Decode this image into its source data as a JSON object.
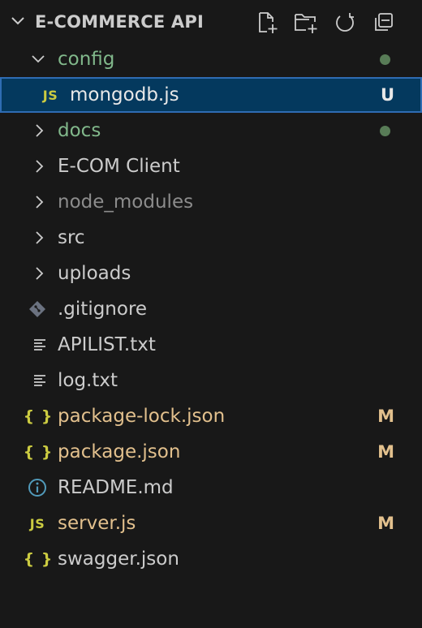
{
  "explorer": {
    "title": "E-COMMERCE API",
    "actions": [
      "new-file",
      "new-folder",
      "refresh",
      "collapse-all"
    ]
  },
  "colors": {
    "folder_modified": "#81b88b",
    "modified_file": "#e2c08d",
    "default_text": "#cccccc",
    "ignored_text": "#8c8c8c",
    "untracked_text": "#e8e8e8",
    "selection_bg": "#04395e",
    "selection_border": "#2f6cb3",
    "js_icon": "#cbcb41",
    "json_icon": "#cbcb41",
    "info_icon": "#519aba",
    "git_icon": "#6b7280"
  },
  "items": [
    {
      "label": "config",
      "kind": "folder",
      "expanded": true,
      "badge": "",
      "dot": true
    },
    {
      "label": "mongodb.js",
      "kind": "js",
      "badge": "U",
      "selected": true
    },
    {
      "label": "docs",
      "kind": "folder",
      "expanded": false,
      "badge": "",
      "dot": true
    },
    {
      "label": "E-COM Client",
      "kind": "folder",
      "expanded": false,
      "badge": ""
    },
    {
      "label": "node_modules",
      "kind": "folder",
      "expanded": false,
      "badge": ""
    },
    {
      "label": "src",
      "kind": "folder",
      "expanded": false,
      "badge": ""
    },
    {
      "label": "uploads",
      "kind": "folder",
      "expanded": false,
      "badge": ""
    },
    {
      "label": ".gitignore",
      "kind": "git",
      "badge": ""
    },
    {
      "label": "APILIST.txt",
      "kind": "txt",
      "badge": ""
    },
    {
      "label": "log.txt",
      "kind": "txt",
      "badge": ""
    },
    {
      "label": "package-lock.json",
      "kind": "json",
      "badge": "M"
    },
    {
      "label": "package.json",
      "kind": "json",
      "badge": "M"
    },
    {
      "label": "README.md",
      "kind": "info",
      "badge": ""
    },
    {
      "label": "server.js",
      "kind": "js",
      "badge": "M"
    },
    {
      "label": "swagger.json",
      "kind": "json",
      "badge": ""
    }
  ],
  "icon_text": {
    "js": "JS",
    "json": "{ }"
  }
}
